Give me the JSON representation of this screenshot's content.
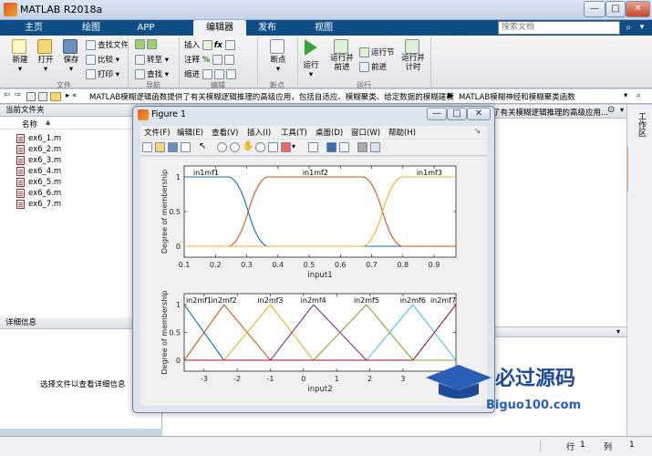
{
  "app": {
    "title": "MATLAB R2018a"
  },
  "tabs": [
    "主页",
    "绘图",
    "APP",
    "编辑器",
    "发布",
    "视图"
  ],
  "search": {
    "placeholder": "搜索文档"
  },
  "ribbon": {
    "file": {
      "new": "新建",
      "open": "打开",
      "save": "保存",
      "find_files": "查找文件",
      "compare": "比较",
      "print": "打印",
      "group": "文件"
    },
    "nav": {
      "goto": "转至",
      "find": "查找",
      "group": "导航"
    },
    "edit": {
      "insert": "插入",
      "comment": "注释",
      "indent": "缩进",
      "group": "编辑"
    },
    "breakpoints": {
      "label": "断点",
      "group": "断点"
    },
    "run": {
      "run": "运行",
      "run_advance": "运行并前进",
      "run_section": "运行节",
      "advance": "前进",
      "run_time": "运行并计时",
      "group": "运行"
    }
  },
  "address": {
    "path": "MATLAB模糊逻辑函数提供了有关模糊逻辑推理的高级应用，包括自适应、模糊聚类、给定数据的模糊建模",
    "sep": "▶",
    "tail": "MATLAB模糊神经和模糊聚类函数",
    "editor_tab": "了有关模糊逻辑推理的高级应用..."
  },
  "left": {
    "header": "当前文件夹",
    "col_name": "名称",
    "files": [
      "ex6_1.m",
      "ex6_2.m",
      "ex6_3.m",
      "ex6_4.m",
      "ex6_5.m",
      "ex6_6.m",
      "ex6_7.m"
    ],
    "detail_header": "详细信息",
    "detail_hint": "选择文件以查看详细信息"
  },
  "right": {
    "tab": "工作区"
  },
  "status": {
    "row_label": "行",
    "row": "1",
    "col_label": "列",
    "col": "1"
  },
  "figure": {
    "title": "Figure 1",
    "menu": [
      "文件(F)",
      "编辑(E)",
      "查看(V)",
      "插入(I)",
      "工具(T)",
      "桌面(D)",
      "窗口(W)",
      "帮助(H)"
    ]
  },
  "watermark": {
    "text": "必过源码",
    "url": "Biguo100.com"
  },
  "colors": {
    "blue": "#0072BD",
    "orange": "#D95319",
    "yellow": "#EDB120",
    "purple": "#7E2F8E",
    "green": "#77AC30",
    "cyan": "#4DBEEE",
    "red": "#A2142F"
  },
  "chart_data": [
    {
      "type": "line",
      "xlabel": "input1",
      "ylabel": "Degree of membership",
      "xlim": [
        0.1,
        0.97
      ],
      "ylim": [
        0,
        1
      ],
      "xticks": [
        "0.1",
        "0.2",
        "0.3",
        "0.4",
        "0.5",
        "0.6",
        "0.7",
        "0.8",
        "0.9"
      ],
      "yticks": [
        "0",
        "0.5",
        "1"
      ],
      "series": [
        {
          "name": "in1mf1",
          "shape": "z",
          "params": [
            0.24,
            0.37
          ],
          "color": "#0072BD"
        },
        {
          "name": "in1mf2",
          "shape": "pi",
          "params": [
            0.24,
            0.37,
            0.67,
            0.8
          ],
          "color": "#D95319"
        },
        {
          "name": "in1mf3",
          "shape": "s",
          "params": [
            0.67,
            0.8
          ],
          "color": "#EDB120"
        }
      ]
    },
    {
      "type": "line",
      "xlabel": "input2",
      "ylabel": "Degree of membership",
      "xlim": [
        -3.6,
        4.6
      ],
      "ylim": [
        0,
        1
      ],
      "xticks": [
        "-3",
        "-2",
        "-1",
        "0",
        "1",
        "2",
        "3"
      ],
      "yticks": [
        "0",
        "0.5",
        "1"
      ],
      "series": [
        {
          "name": "in2mf1",
          "shape": "tri",
          "params": [
            -4.9,
            -3.6,
            -2.4
          ],
          "color": "#0072BD"
        },
        {
          "name": "in2mf2",
          "shape": "tri",
          "params": [
            -3.6,
            -2.4,
            -1.0
          ],
          "color": "#D95319"
        },
        {
          "name": "in2mf3",
          "shape": "tri",
          "params": [
            -2.4,
            -1.0,
            0.3
          ],
          "color": "#EDB120"
        },
        {
          "name": "in2mf4",
          "shape": "tri",
          "params": [
            -1.0,
            0.3,
            1.9
          ],
          "color": "#7E2F8E"
        },
        {
          "name": "in2mf5",
          "shape": "tri",
          "params": [
            0.3,
            1.9,
            3.3
          ],
          "color": "#77AC30"
        },
        {
          "name": "in2mf6",
          "shape": "tri",
          "params": [
            1.9,
            3.3,
            4.6
          ],
          "color": "#4DBEEE"
        },
        {
          "name": "in2mf7",
          "shape": "tri",
          "params": [
            3.3,
            4.6,
            5.9
          ],
          "color": "#A2142F"
        }
      ]
    }
  ]
}
